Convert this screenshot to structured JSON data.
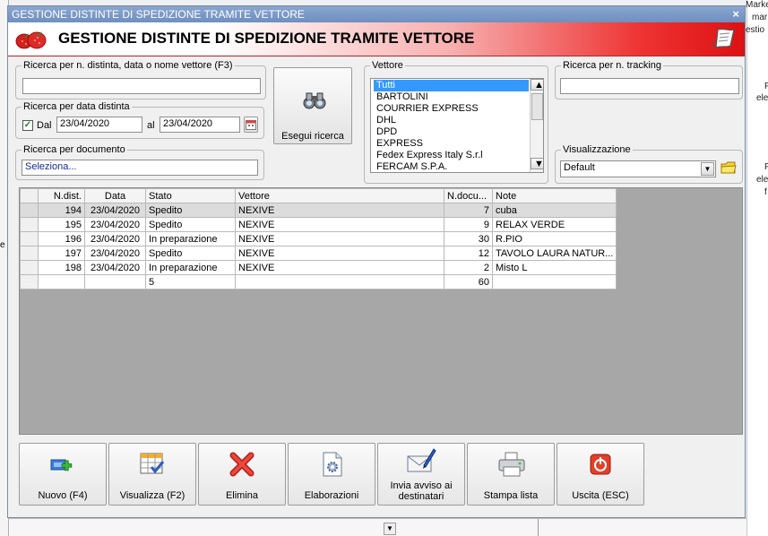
{
  "background": {
    "right_fragments": [
      "Marke",
      "mar",
      "estio",
      "F",
      "ele",
      "F",
      "ele",
      "f"
    ],
    "left_fragments": [
      "e"
    ]
  },
  "window": {
    "title": "GESTIONE DISTINTE DI SPEDIZIONE TRAMITE VETTORE",
    "close_glyph": "×",
    "header_title": "GESTIONE DISTINTE DI SPEDIZIONE TRAMITE VETTORE"
  },
  "search": {
    "distinta_label": "Ricerca per n. distinta, data o nome vettore (F3)",
    "distinta_value": "",
    "date_group_label": "Ricerca per data distinta",
    "dal_label": "Dal",
    "dal_checked": true,
    "date_from": "23/04/2020",
    "al_label": "al",
    "date_to": "23/04/2020",
    "document_label": "Ricerca per documento",
    "document_value": "Seleziona...",
    "search_button": "Esegui ricerca",
    "tracking_label": "Ricerca per n. tracking",
    "tracking_value": ""
  },
  "vettore": {
    "label": "Vettore",
    "items": [
      "Tutti",
      "BARTOLINI",
      "COURRIER EXPRESS",
      "DHL",
      "DPD",
      "EXPRESS",
      "Fedex Express Italy S.r.l",
      "FERCAM S.P.A."
    ],
    "selected": "Tutti"
  },
  "visualizzazione": {
    "label": "Visualizzazione",
    "value": "Default"
  },
  "table": {
    "columns": [
      "N.dist.",
      "Data",
      "Stato",
      "Vettore",
      "N.docu...",
      "Note"
    ],
    "rows": [
      [
        "194",
        "23/04/2020",
        "Spedito",
        "NEXIVE",
        "7",
        "cuba"
      ],
      [
        "195",
        "23/04/2020",
        "Spedito",
        "NEXIVE",
        "9",
        "RELAX VERDE"
      ],
      [
        "196",
        "23/04/2020",
        "In preparazione",
        "NEXIVE",
        "30",
        "R.PIO"
      ],
      [
        "197",
        "23/04/2020",
        "Spedito",
        "NEXIVE",
        "12",
        "TAVOLO LAURA NATUR..."
      ],
      [
        "198",
        "23/04/2020",
        "In preparazione",
        "NEXIVE",
        "2",
        "Misto L"
      ]
    ],
    "totals": [
      "",
      "",
      "5",
      "",
      "60",
      ""
    ]
  },
  "toolbar": {
    "buttons": [
      {
        "label": "Nuovo (F4)",
        "icon": "new-icon"
      },
      {
        "label": "Visualizza (F2)",
        "icon": "view-icon"
      },
      {
        "label": "Elimina",
        "icon": "delete-icon"
      },
      {
        "label": "Elaborazioni",
        "icon": "process-icon"
      },
      {
        "label": "Invia avviso ai destinatari",
        "icon": "mail-icon"
      },
      {
        "label": "Stampa lista",
        "icon": "printer-icon"
      },
      {
        "label": "Uscita (ESC)",
        "icon": "exit-icon"
      }
    ]
  },
  "colors": {
    "selection": "#3399ff",
    "header_red": "#dd1111",
    "grid_bg": "#a7a7a7"
  }
}
